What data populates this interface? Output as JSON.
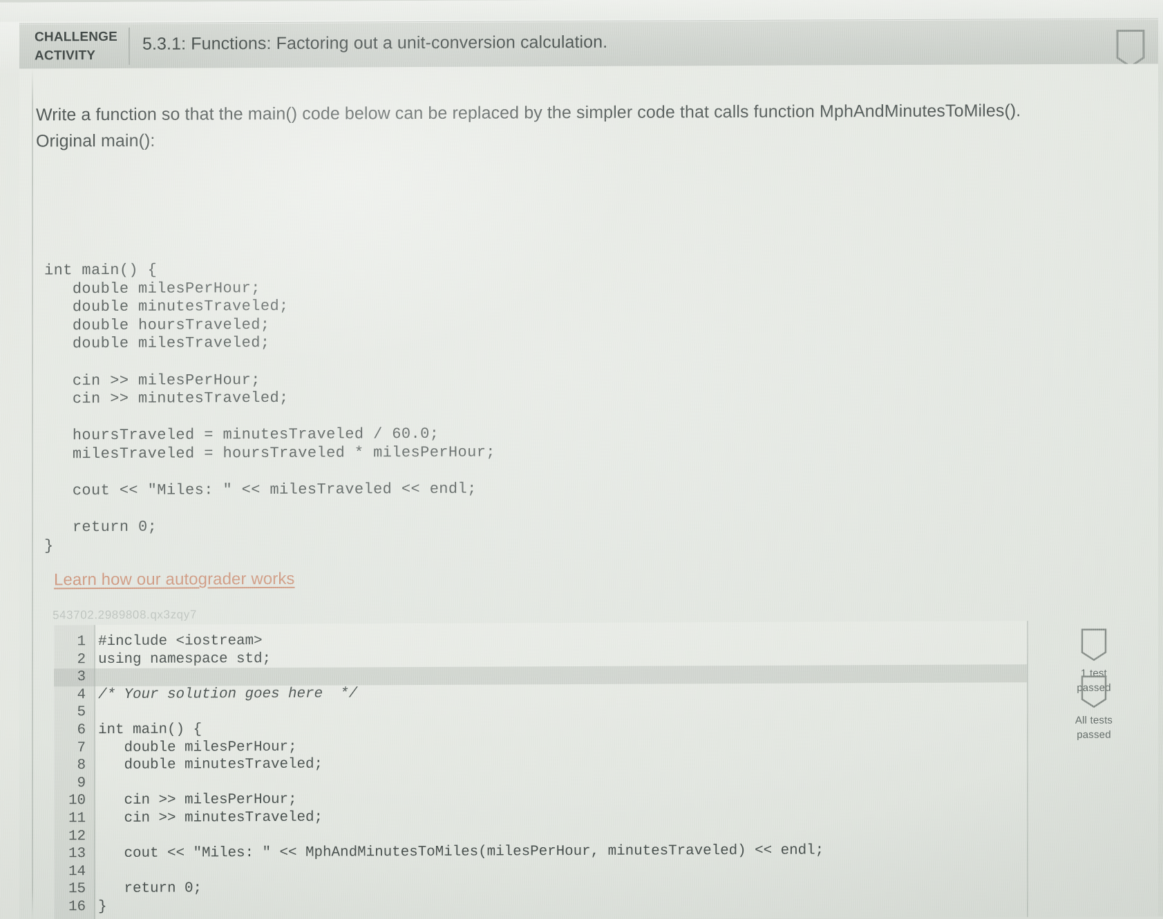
{
  "header": {
    "challenge_label_line1": "CHALLENGE",
    "challenge_label_line2": "ACTIVITY",
    "activity_title": "5.3.1: Functions: Factoring out a unit-conversion calculation.",
    "badge_icon": "shield-badge-icon"
  },
  "prompt": {
    "line1": "Write a function so that the main() code below can be replaced by the simpler code that calls function MphAndMinutesToMiles().",
    "line2": "Original main():"
  },
  "sample_code": "int main() {\n   double milesPerHour;\n   double minutesTraveled;\n   double hoursTraveled;\n   double milesTraveled;\n\n   cin >> milesPerHour;\n   cin >> minutesTraveled;\n\n   hoursTraveled = minutesTraveled / 60.0;\n   milesTraveled = hoursTraveled * milesPerHour;\n\n   cout << \"Miles: \" << milesTraveled << endl;\n\n   return 0;\n}",
  "autograder_link": "Learn how our autograder works",
  "submission_id": "543702.2989808.qx3zqy7",
  "editor": {
    "lines": [
      {
        "n": "1",
        "text": "#include <iostream>",
        "active": false,
        "comment": false
      },
      {
        "n": "2",
        "text": "using namespace std;",
        "active": false,
        "comment": false
      },
      {
        "n": "3",
        "text": "",
        "active": true,
        "comment": false
      },
      {
        "n": "4",
        "text": "/* Your solution goes here  */",
        "active": false,
        "comment": true
      },
      {
        "n": "5",
        "text": "",
        "active": false,
        "comment": false
      },
      {
        "n": "6",
        "text": "int main() {",
        "active": false,
        "comment": false
      },
      {
        "n": "7",
        "text": "   double milesPerHour;",
        "active": false,
        "comment": false
      },
      {
        "n": "8",
        "text": "   double minutesTraveled;",
        "active": false,
        "comment": false
      },
      {
        "n": "9",
        "text": "",
        "active": false,
        "comment": false
      },
      {
        "n": "10",
        "text": "   cin >> milesPerHour;",
        "active": false,
        "comment": false
      },
      {
        "n": "11",
        "text": "   cin >> minutesTraveled;",
        "active": false,
        "comment": false
      },
      {
        "n": "12",
        "text": "",
        "active": false,
        "comment": false
      },
      {
        "n": "13",
        "text": "   cout << \"Miles: \" << MphAndMinutesToMiles(milesPerHour, minutesTraveled) << endl;",
        "active": false,
        "comment": false
      },
      {
        "n": "14",
        "text": "",
        "active": false,
        "comment": false
      },
      {
        "n": "15",
        "text": "   return 0;",
        "active": false,
        "comment": false
      },
      {
        "n": "16",
        "text": "}",
        "active": false,
        "comment": false
      }
    ]
  },
  "tests": [
    {
      "icon": "shield-badge-icon",
      "caption_line1": "1 test",
      "caption_line2": "passed"
    },
    {
      "icon": "shield-badge-icon",
      "caption_line1": "All tests",
      "caption_line2": "passed"
    }
  ],
  "colors": {
    "link": "#c98d74",
    "header_bg": "#c9cec8",
    "page_bg": "#e0e4de",
    "text": "#454c4a"
  }
}
